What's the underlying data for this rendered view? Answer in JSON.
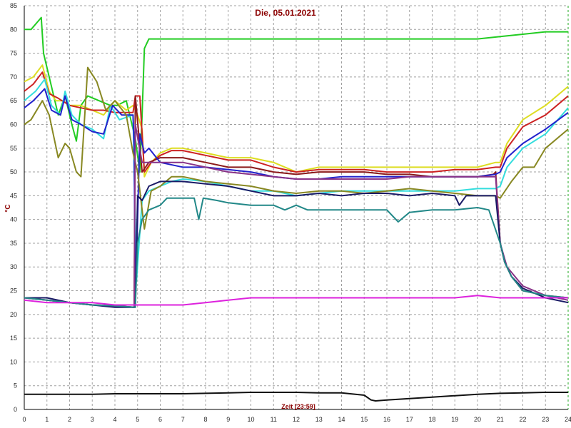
{
  "chart_data": {
    "type": "line",
    "title": "Die, 05.01.2021",
    "xlabel": "Zeit [23:59]",
    "ylabel": "°C",
    "xlim": [
      0,
      24
    ],
    "ylim": [
      0,
      85
    ],
    "x_ticks": [
      0,
      1,
      2,
      3,
      4,
      5,
      6,
      7,
      8,
      9,
      10,
      11,
      12,
      13,
      14,
      15,
      16,
      17,
      18,
      19,
      20,
      21,
      22,
      23,
      24
    ],
    "y_ticks": [
      0,
      5,
      10,
      15,
      20,
      25,
      30,
      35,
      40,
      45,
      50,
      55,
      60,
      65,
      70,
      75,
      80,
      85
    ],
    "grid": true,
    "series": [
      {
        "color": "#22cc22",
        "x": [
          0,
          0.3,
          0.75,
          0.85,
          1.2,
          1.5,
          1.8,
          2.1,
          2.3,
          2.5,
          2.8,
          3.3,
          3.8,
          4.1,
          4.5,
          4.9,
          5.1,
          5.2,
          5.3,
          5.5,
          6,
          8,
          10,
          12,
          14,
          16,
          18,
          20,
          21,
          22,
          23,
          24
        ],
        "y": [
          80,
          80,
          82.5,
          75,
          68,
          62,
          66,
          60,
          56.5,
          64,
          66,
          65,
          64,
          64,
          65,
          57,
          50,
          62,
          76,
          78,
          78,
          78,
          78,
          78,
          78,
          78,
          78,
          78,
          78.5,
          79,
          79.5,
          79.5
        ]
      },
      {
        "color": "#dddd22",
        "x": [
          0,
          0.4,
          0.8,
          1.1,
          1.4,
          1.7,
          2,
          2.5,
          3,
          3.5,
          4,
          4.5,
          4.8,
          5,
          5.2,
          5.3,
          5.6,
          6,
          6.5,
          7,
          8,
          9,
          10,
          11,
          12,
          13,
          14,
          15,
          16,
          17,
          18,
          19,
          20,
          20.8,
          21,
          21.3,
          22,
          23,
          24
        ],
        "y": [
          69,
          70,
          72.5,
          67,
          65,
          65,
          64,
          64,
          63,
          62,
          65,
          63,
          64,
          62,
          59,
          49,
          52,
          54,
          55,
          55,
          54,
          53,
          53,
          52,
          50,
          51,
          51,
          51,
          51,
          51,
          51,
          51,
          51,
          52,
          52,
          56,
          61,
          64,
          68
        ]
      },
      {
        "color": "#cc2222",
        "x": [
          0,
          0.4,
          0.8,
          1.1,
          1.5,
          2,
          2.5,
          3,
          3.5,
          4,
          4.5,
          4.8,
          4.9,
          5.1,
          5.2,
          5.3,
          5.6,
          6,
          6.5,
          7,
          8,
          9,
          10,
          11,
          12,
          13,
          14,
          15,
          16,
          17,
          18,
          19,
          20,
          20.8,
          21,
          21.3,
          22,
          23,
          24
        ],
        "y": [
          67,
          68.5,
          71,
          66.5,
          65.5,
          64,
          63.5,
          63,
          63,
          62.5,
          62.5,
          62.5,
          66,
          66,
          58,
          50,
          52,
          53.5,
          54.5,
          54.5,
          53.5,
          52.5,
          52.5,
          51,
          50,
          50.5,
          50.5,
          50.5,
          50,
          50,
          50,
          50.5,
          50.5,
          51,
          51,
          55,
          59.5,
          62,
          66
        ]
      },
      {
        "color": "#8b1a1a",
        "x": [
          0,
          1,
          2,
          3,
          4,
          4.85,
          4.9,
          5.2,
          5.5,
          6,
          7,
          8,
          9,
          10,
          11,
          12,
          13,
          14,
          15,
          16,
          17,
          18,
          19,
          20,
          20.7,
          20.8,
          21,
          21.2,
          21.5,
          22,
          23,
          24
        ],
        "y": [
          23.5,
          23,
          22.5,
          22,
          21.8,
          21.5,
          66,
          50,
          52,
          53,
          53,
          52,
          51,
          51,
          50,
          49.5,
          50,
          50,
          50,
          49.5,
          49.5,
          49,
          49,
          49,
          49.5,
          50,
          35,
          31,
          28,
          25,
          24,
          23.5
        ]
      },
      {
        "color": "#33dddd",
        "x": [
          0,
          0.5,
          0.9,
          1.2,
          1.6,
          1.8,
          2.1,
          2.5,
          3,
          3.5,
          3.8,
          4.2,
          4.8,
          4.95,
          5.2,
          5.5,
          6,
          6.5,
          7,
          8,
          9,
          10,
          11,
          12,
          13,
          14,
          15,
          16,
          17,
          18,
          19,
          20,
          20.8,
          21,
          21.3,
          22,
          23,
          24
        ],
        "y": [
          65,
          67,
          69.5,
          64,
          62,
          67,
          62,
          60,
          59,
          57,
          64,
          61,
          62,
          27,
          44,
          46,
          47,
          48,
          48.5,
          48,
          47,
          46,
          46,
          45,
          45.5,
          46,
          46,
          46,
          46,
          46,
          46,
          46.5,
          46.5,
          47,
          51,
          55,
          58,
          63.5
        ]
      },
      {
        "color": "#2222cc",
        "x": [
          0,
          0.4,
          0.9,
          1.2,
          1.6,
          1.8,
          2.1,
          2.5,
          3,
          3.5,
          3.9,
          4.3,
          4.8,
          4.85,
          4.9,
          5.1,
          5.3,
          5.5,
          6,
          7,
          8,
          9,
          10,
          11,
          12,
          13,
          14,
          15,
          16,
          17,
          18,
          19,
          20,
          20.8,
          21,
          21.3,
          22,
          23,
          24
        ],
        "y": [
          63.5,
          65,
          67.5,
          63,
          62,
          66,
          61,
          60,
          58.5,
          58,
          64,
          62,
          62,
          55,
          22,
          58,
          54,
          55,
          52,
          51,
          51,
          50.5,
          50,
          49,
          48.5,
          48.5,
          49,
          49,
          49,
          49,
          49,
          49,
          49,
          49.5,
          50,
          53,
          56,
          59,
          62.5
        ]
      },
      {
        "color": "#888822",
        "x": [
          0,
          0.3,
          0.8,
          1.1,
          1.5,
          1.8,
          2,
          2.3,
          2.5,
          2.8,
          3.2,
          3.6,
          4,
          4.5,
          4.8,
          5,
          5.3,
          5.6,
          6,
          6.5,
          7,
          8,
          9,
          10,
          11,
          12,
          13,
          14,
          15,
          16,
          17,
          18,
          19,
          20,
          20.8,
          21,
          21.5,
          22,
          22.5,
          23,
          24
        ],
        "y": [
          60,
          61,
          65,
          62,
          53,
          56,
          55,
          50,
          49,
          72,
          69,
          63,
          65,
          62,
          54,
          50,
          38,
          46,
          47,
          49,
          49,
          48,
          47.5,
          47,
          46,
          45.5,
          46,
          46,
          45.5,
          46,
          46.5,
          46,
          45.5,
          45,
          45,
          44.5,
          48,
          51,
          51,
          55,
          59
        ]
      },
      {
        "color": "#883388",
        "x": [
          0,
          1,
          2,
          3,
          4,
          4.85,
          4.9,
          5.2,
          5.5,
          6,
          7,
          8,
          9,
          10,
          11,
          12,
          13,
          14,
          15,
          16,
          17,
          18,
          19,
          20,
          20.8,
          21,
          21.3,
          22,
          23,
          24
        ],
        "y": [
          23.5,
          23,
          22.5,
          22,
          21.8,
          21.5,
          60,
          52,
          52,
          52,
          52,
          51,
          50,
          49.5,
          49,
          48.5,
          48.5,
          48.5,
          48.5,
          48.5,
          49,
          49,
          49,
          49,
          49,
          35,
          30,
          26,
          24,
          23
        ]
      },
      {
        "color": "#1a1a66",
        "x": [
          0,
          1,
          2,
          3,
          4,
          4.9,
          5,
          5.2,
          5.5,
          6,
          6.5,
          7,
          8,
          9,
          10,
          11,
          12,
          13,
          14,
          15,
          16,
          17,
          18,
          19,
          19.2,
          19.5,
          20,
          20.8,
          21,
          21.2,
          21.5,
          22,
          23,
          24
        ],
        "y": [
          23.5,
          23.5,
          22.5,
          22,
          21.5,
          21.5,
          45,
          44,
          47,
          48,
          48,
          48,
          47.5,
          47,
          46,
          45,
          45,
          45.5,
          45,
          45.5,
          45.5,
          45,
          45.5,
          45,
          43,
          45,
          45,
          45,
          35,
          31,
          28,
          25.5,
          23.5,
          22.5
        ]
      },
      {
        "color": "#228888",
        "x": [
          0,
          1,
          2,
          3,
          4,
          4.9,
          5,
          5.2,
          5.5,
          6,
          6.3,
          7,
          7.5,
          7.7,
          7.9,
          8.5,
          9,
          10,
          11,
          11.5,
          12,
          12.5,
          13,
          14,
          15,
          16,
          16.5,
          17,
          18,
          19,
          20,
          20.5,
          21,
          21.2,
          21.5,
          22,
          23,
          24
        ],
        "y": [
          23.5,
          23,
          22.5,
          22,
          21.8,
          21.5,
          35,
          40,
          42,
          43,
          44.5,
          44.5,
          44.5,
          40,
          44.5,
          44,
          43.5,
          43,
          43,
          42,
          43,
          42,
          42,
          42,
          42,
          42,
          39.5,
          41.5,
          42,
          42,
          42.5,
          42,
          35,
          31,
          28,
          25,
          24,
          23.5
        ]
      },
      {
        "color": "#dd22dd",
        "x": [
          0,
          1,
          2,
          3,
          4,
          5,
          6,
          7,
          8,
          9,
          10,
          11,
          12,
          13,
          14,
          15,
          16,
          17,
          18,
          19,
          20,
          21,
          22,
          23,
          24
        ],
        "y": [
          23,
          22.5,
          22.5,
          22.5,
          22,
          22,
          22,
          22,
          22.5,
          23,
          23.5,
          23.5,
          23.5,
          23.5,
          23.5,
          23.5,
          23.5,
          23.5,
          23.5,
          23.5,
          24,
          23.5,
          23.5,
          23.5,
          23.5
        ]
      },
      {
        "color": "#111111",
        "x": [
          0,
          1,
          2,
          3,
          4,
          5,
          6,
          7,
          8,
          9,
          10,
          11,
          12,
          13,
          14,
          15,
          15.3,
          15.5,
          16,
          17,
          18,
          19,
          20,
          21,
          22,
          23,
          24
        ],
        "y": [
          3.2,
          3.2,
          3.2,
          3.2,
          3.3,
          3.3,
          3.3,
          3.3,
          3.4,
          3.5,
          3.6,
          3.6,
          3.6,
          3.5,
          3.5,
          3,
          2,
          1.8,
          2,
          2.3,
          2.6,
          2.9,
          3.2,
          3.4,
          3.5,
          3.6,
          3.6
        ]
      }
    ]
  }
}
